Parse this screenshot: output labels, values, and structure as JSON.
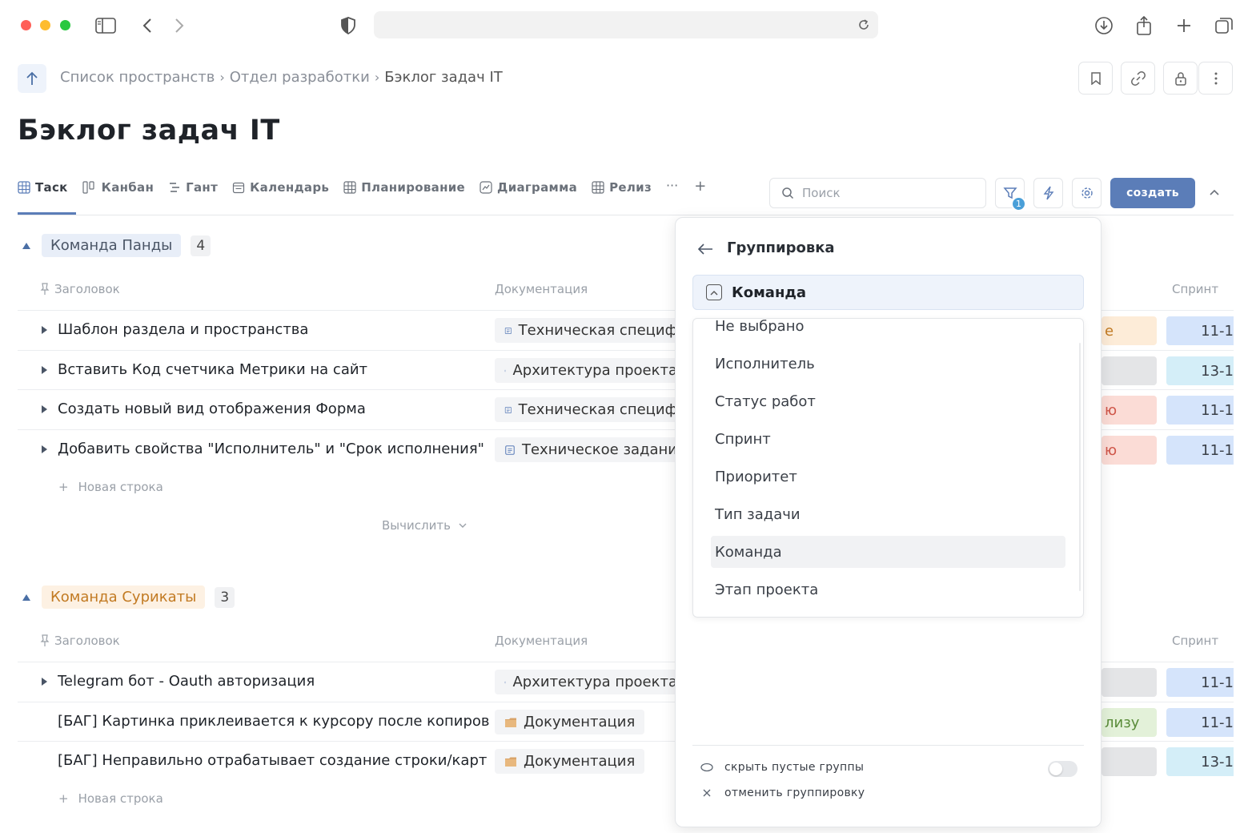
{
  "breadcrumb": {
    "items": [
      "Список пространств",
      "Отдел разработки"
    ],
    "current": "Бэклог задач IT",
    "separator": "›"
  },
  "page": {
    "title": "Бэклог задач IT"
  },
  "tabs": [
    {
      "label": "Таск",
      "icon": "table-icon",
      "active": true
    },
    {
      "label": "Канбан",
      "icon": "kanban-icon"
    },
    {
      "label": "Гант",
      "icon": "gantt-icon"
    },
    {
      "label": "Календарь",
      "icon": "calendar-icon"
    },
    {
      "label": "Планирование",
      "icon": "table-icon"
    },
    {
      "label": "Диаграмма",
      "icon": "chart-icon"
    },
    {
      "label": "Релиз",
      "icon": "table-icon"
    }
  ],
  "toolbar": {
    "more": "···",
    "add_tab": "+",
    "search_placeholder": "Поиск",
    "filter_count": "1",
    "create_label": "создать"
  },
  "columns": {
    "title": "Заголовок",
    "docs": "Документация",
    "sprint": "Спринт"
  },
  "groups": [
    {
      "name": "Команда Панды",
      "count": "4",
      "rows": [
        {
          "title": "Шаблон раздела и пространства",
          "doc": "Техническая специф",
          "status": "е",
          "sprint": "11-1"
        },
        {
          "title": "Вставить Код счетчика Метрики на сайт",
          "doc": "Архитектура проекта",
          "status": "",
          "sprint": "13-1"
        },
        {
          "title": "Создать новый вид отображения Форма",
          "doc": "Техническая специф",
          "status": "ю",
          "sprint": "11-1"
        },
        {
          "title": "Добавить свойства \"Исполнитель\" и \"Срок исполнения\"",
          "doc": "Техническое задани",
          "status": "ю",
          "sprint": "11-1"
        }
      ]
    },
    {
      "name": "Команда Сурикаты",
      "count": "3",
      "rows": [
        {
          "title": "Telegram бот - Oauth авторизация",
          "doc": "Архитектура проекта",
          "status": "",
          "sprint": "11-1"
        },
        {
          "title": "[БАГ] Картинка приклеивается к курсору после копиров",
          "doc": "Документация",
          "status": "лизу",
          "sprint": "11-1"
        },
        {
          "title": "[БАГ] Неправильно отрабатывает создание строки/карт",
          "doc": "Документация",
          "status": "",
          "sprint": "13-1"
        }
      ]
    }
  ],
  "table": {
    "new_row": "Новая строка",
    "compute": "Вычислить"
  },
  "grouping_panel": {
    "title": "Группировка",
    "selected": "Команда",
    "options": [
      "Не выбрано",
      "Исполнитель",
      "Статус работ",
      "Спринт",
      "Приоритет",
      "Тип задачи",
      "Команда",
      "Этап проекта"
    ],
    "selected_option": "Команда",
    "hide_empty_label": "скрыть пустые группы",
    "hide_empty_enabled": false,
    "cancel_label": "отменить группировку"
  },
  "colors": {
    "accent": "#5b7db8",
    "status_orange": "#fdecd8",
    "status_gray": "#e4e5e7",
    "status_red": "#fbdcd6",
    "status_green": "#e3f1d9",
    "sprint_blue": "#d5e4fb",
    "sprint_cyan": "#d4eef8"
  }
}
